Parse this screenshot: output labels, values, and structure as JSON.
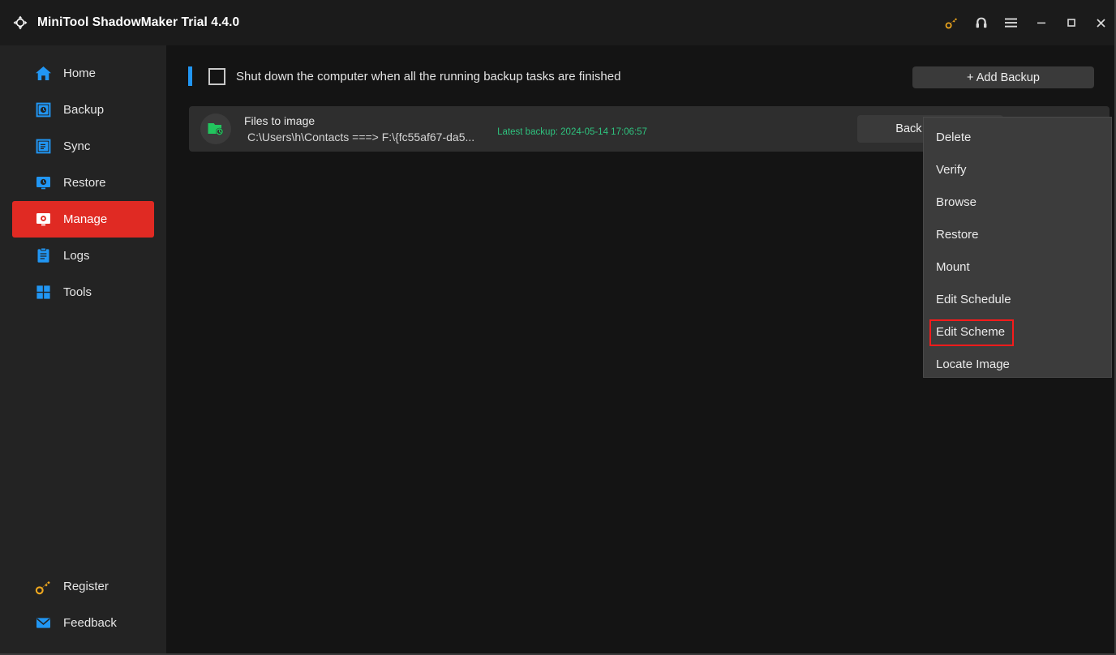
{
  "titlebar": {
    "app_title": "MiniTool ShadowMaker Trial 4.4.0",
    "logo_icon": "shadowmaker-logo-icon",
    "actions": [
      {
        "name": "register-key-icon",
        "glyph": "key",
        "color": "#f0a81e"
      },
      {
        "name": "support-headset-icon",
        "glyph": "headset",
        "color": "#d8d8d8"
      },
      {
        "name": "menu-hamburger-icon",
        "glyph": "hamburger",
        "color": "#d8d8d8"
      },
      {
        "name": "minimize-button",
        "glyph": "minimize",
        "color": "#d8d8d8"
      },
      {
        "name": "maximize-button",
        "glyph": "maximize",
        "color": "#d8d8d8"
      },
      {
        "name": "close-button",
        "glyph": "close",
        "color": "#d8d8d8"
      }
    ]
  },
  "sidebar": {
    "active_index": 4,
    "active_color": "#e02a23",
    "icon_color": "#2196f3",
    "items": [
      {
        "label": "Home",
        "icon": "home-icon"
      },
      {
        "label": "Backup",
        "icon": "backup-icon"
      },
      {
        "label": "Sync",
        "icon": "sync-icon"
      },
      {
        "label": "Restore",
        "icon": "restore-icon"
      },
      {
        "label": "Manage",
        "icon": "manage-icon"
      },
      {
        "label": "Logs",
        "icon": "logs-icon"
      },
      {
        "label": "Tools",
        "icon": "tools-icon"
      }
    ],
    "bottom_items": [
      {
        "label": "Register",
        "icon": "key-icon",
        "color": "#f0a81e"
      },
      {
        "label": "Feedback",
        "icon": "envelope-icon",
        "color": "#2196f3"
      }
    ]
  },
  "toolbar": {
    "shutdown_checkbox_label": "Shut down the computer when all the running backup tasks are finished",
    "shutdown_checked": false,
    "accent_color": "#2196f3",
    "add_backup_label": "+ Add Backup"
  },
  "backup_task": {
    "icon": "folder-backup-icon",
    "title": "Files to image",
    "path": "C:\\Users\\h\\Contacts ===> F:\\{fc55af67-da5...",
    "latest_backup": "Latest backup: 2024-05-14 17:06:57",
    "latest_backup_color": "#2ec27e",
    "backup_now_label": "Back up Now"
  },
  "context_menu": {
    "highlight_index": 6,
    "highlight_color": "#f51b1b",
    "items": [
      {
        "label": "Delete"
      },
      {
        "label": "Verify"
      },
      {
        "label": "Browse"
      },
      {
        "label": "Restore"
      },
      {
        "label": "Mount"
      },
      {
        "label": "Edit Schedule"
      },
      {
        "label": "Edit Scheme"
      },
      {
        "label": "Locate Image"
      }
    ]
  }
}
